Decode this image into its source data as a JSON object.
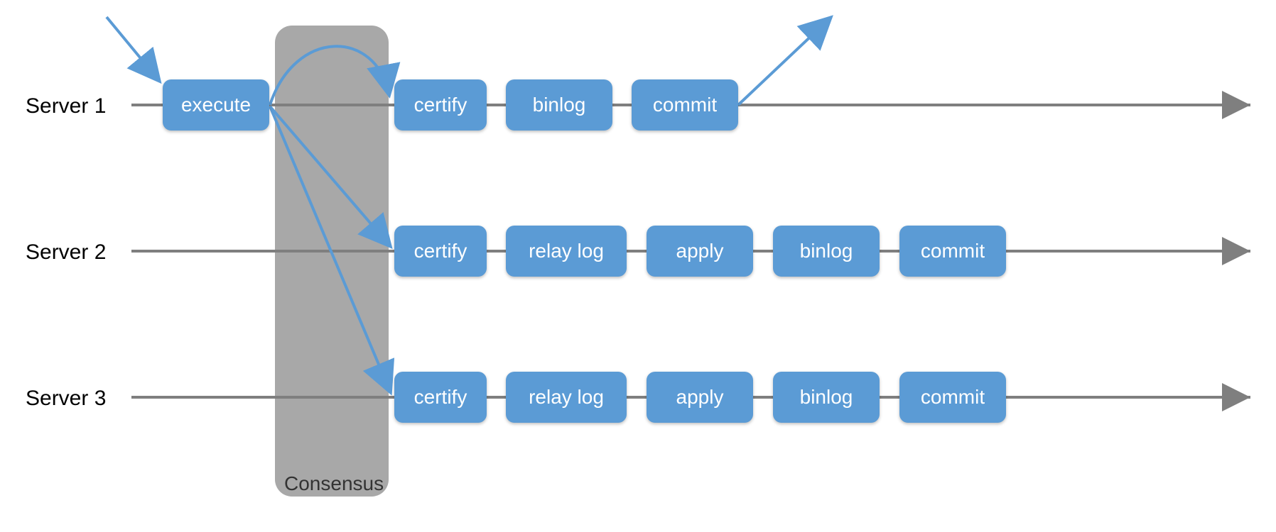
{
  "consensus_label": "Consensus",
  "row1_label": "Server 1",
  "row2_label": "Server 2",
  "row3_label": "Server 3",
  "boxes": {
    "execute": "execute",
    "certify": "certify",
    "binlog": "binlog",
    "commit": "commit",
    "relay_log": "relay log",
    "apply": "apply"
  },
  "colors": {
    "pill": "#5b9bd5",
    "consensus_bg": "#a8a8a8",
    "arrow_gray": "#7f7f7f",
    "arrow_blue": "#5b9bd5"
  }
}
